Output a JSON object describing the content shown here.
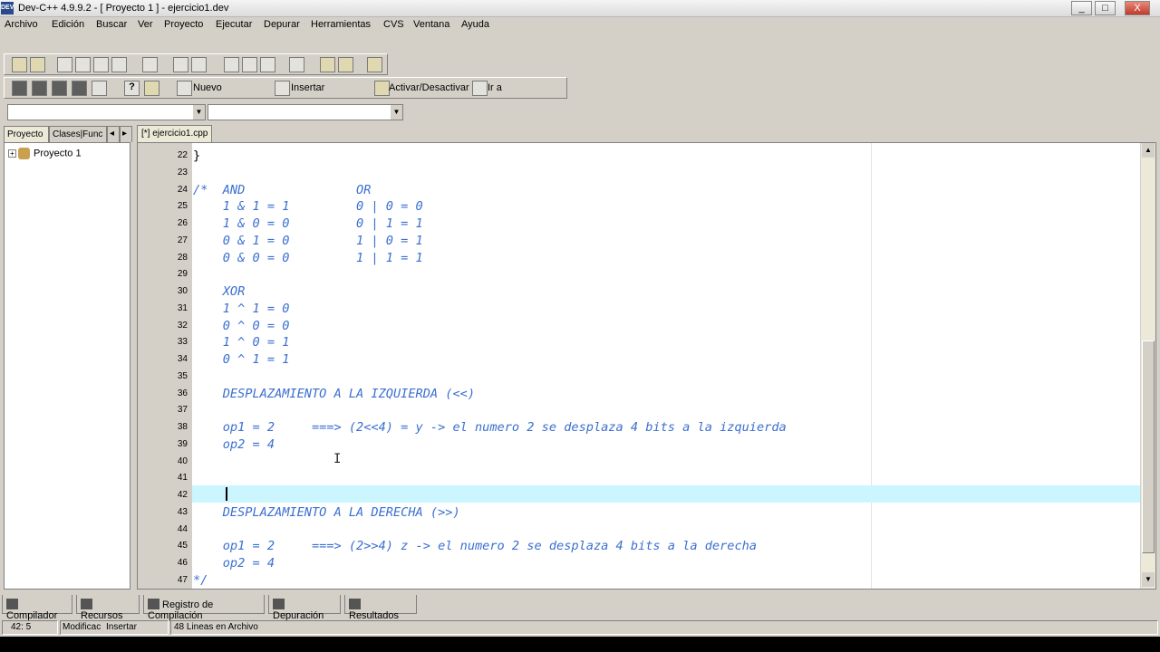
{
  "window": {
    "title": "Dev-C++ 4.9.9.2  -  [ Proyecto 1 ] - ejercicio1.dev",
    "app_icon": "DEV",
    "controls": [
      "_",
      "□",
      "X"
    ]
  },
  "menu": [
    "Archivo",
    "Edición",
    "Buscar",
    "Ver",
    "Proyecto",
    "Ejecutar",
    "Depurar",
    "Herramientas",
    "CVS",
    "Ventana",
    "Ayuda"
  ],
  "toolbar2": {
    "nuevo": "Nuevo",
    "insertar": "Insertar",
    "activar": "Activar/Desactivar",
    "ira": "Ir a",
    "help": "?"
  },
  "left_panel": {
    "tabs": [
      "Proyecto",
      "Clases|Func"
    ],
    "tree": [
      {
        "label": "Proyecto 1",
        "expanded": false
      }
    ]
  },
  "editor": {
    "tab": "[*] ejercicio1.cpp",
    "lines": [
      {
        "n": "22",
        "t": "}",
        "plain": true
      },
      {
        "n": "23",
        "t": ""
      },
      {
        "n": "24",
        "t": "/*  AND               OR"
      },
      {
        "n": "25",
        "t": "    1 & 1 = 1         0 | 0 = 0"
      },
      {
        "n": "26",
        "t": "    1 & 0 = 0         0 | 1 = 1"
      },
      {
        "n": "27",
        "t": "    0 & 1 = 0         1 | 0 = 1"
      },
      {
        "n": "28",
        "t": "    0 & 0 = 0         1 | 1 = 1"
      },
      {
        "n": "29",
        "t": ""
      },
      {
        "n": "30",
        "t": "    XOR"
      },
      {
        "n": "31",
        "t": "    1 ^ 1 = 0"
      },
      {
        "n": "32",
        "t": "    0 ^ 0 = 0"
      },
      {
        "n": "33",
        "t": "    1 ^ 0 = 1"
      },
      {
        "n": "34",
        "t": "    0 ^ 1 = 1"
      },
      {
        "n": "35",
        "t": ""
      },
      {
        "n": "36",
        "t": "    DESPLAZAMIENTO A LA IZQUIERDA (<<)"
      },
      {
        "n": "37",
        "t": ""
      },
      {
        "n": "38",
        "t": "    op1 = 2     ===> (2<<4) = y -> el numero 2 se desplaza 4 bits a la izquierda"
      },
      {
        "n": "39",
        "t": "    op2 = 4"
      },
      {
        "n": "40",
        "t": ""
      },
      {
        "n": "41",
        "t": ""
      },
      {
        "n": "42",
        "t": ""
      },
      {
        "n": "43",
        "t": "    DESPLAZAMIENTO A LA DERECHA (>>)"
      },
      {
        "n": "44",
        "t": ""
      },
      {
        "n": "45",
        "t": "    op1 = 2     ===> (2>>4) z -> el numero 2 se desplaza 4 bits a la derecha"
      },
      {
        "n": "46",
        "t": "    op2 = 4"
      },
      {
        "n": "47",
        "t": "*/"
      }
    ]
  },
  "bottom_tabs": [
    "Compilador",
    "Recursos",
    "Registro de Compilación",
    "Depuración",
    "Resultados"
  ],
  "status": {
    "position": "42: 5",
    "modified": "Modificac",
    "mode": "Insertar",
    "lines": "48 Lineas en Archivo"
  },
  "colors": {
    "comment": "#3b6fd0",
    "current_line": "#ccf6ff"
  }
}
